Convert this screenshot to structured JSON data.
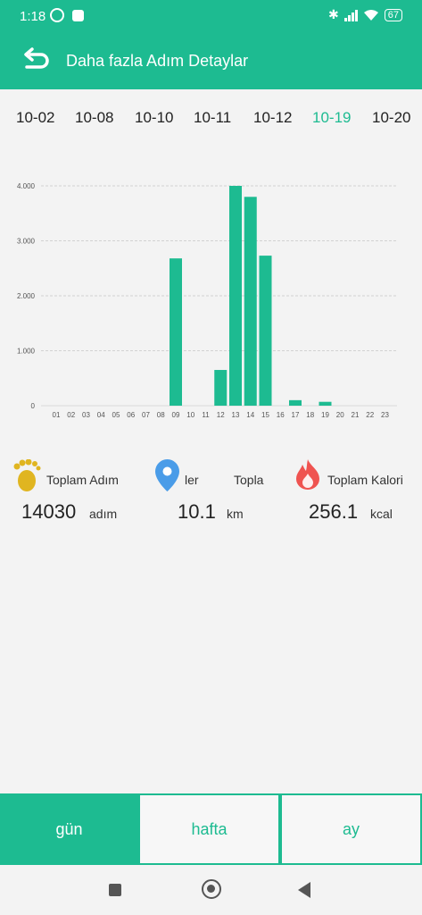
{
  "status_bar": {
    "time": "1:18",
    "battery": "67",
    "icons": [
      "alarm-icon",
      "notification-icon",
      "bluetooth-icon",
      "signal-icon",
      "wifi-icon",
      "battery-icon"
    ]
  },
  "app_bar": {
    "title": "Daha fazla Adım Detaylar",
    "back_icon": "back-arrow-icon"
  },
  "date_tabs": [
    {
      "label": "10-02"
    },
    {
      "label": "10-08"
    },
    {
      "label": "10-10"
    },
    {
      "label": "10-11"
    },
    {
      "label": "10-12"
    },
    {
      "label": "10-19",
      "active": true
    },
    {
      "label": "10-20"
    }
  ],
  "chart_data": {
    "type": "bar",
    "color": "#1dbb91",
    "categories": [
      "01",
      "02",
      "03",
      "04",
      "05",
      "06",
      "07",
      "08",
      "09",
      "10",
      "11",
      "12",
      "13",
      "14",
      "15",
      "16",
      "17",
      "18",
      "19",
      "20",
      "21",
      "22",
      "23"
    ],
    "values": [
      0,
      0,
      0,
      0,
      0,
      0,
      0,
      0,
      2680,
      0,
      0,
      650,
      4000,
      3800,
      2730,
      0,
      100,
      0,
      70,
      0,
      0,
      0,
      0
    ],
    "ylim": [
      0,
      4000
    ],
    "yticks": [
      "0",
      "1.000",
      "2.000",
      "3.000",
      "4.000"
    ],
    "ytick_values": [
      0,
      1000,
      2000,
      3000,
      4000
    ],
    "grid": true
  },
  "stats": {
    "steps": {
      "label": "Toplam Adım",
      "value": "14030",
      "unit": "adım",
      "icon": "footprints-icon"
    },
    "distance": {
      "label_left": "ler",
      "label_right": "Topla",
      "value": "10.1",
      "unit": "km",
      "icon": "location-pin-icon"
    },
    "calories": {
      "label": "Toplam Kalori",
      "value": "256.1",
      "unit": "kcal",
      "icon": "flame-icon"
    }
  },
  "periods": [
    {
      "label": "gün",
      "active": true
    },
    {
      "label": "hafta"
    },
    {
      "label": "ay"
    }
  ],
  "nav": {
    "icons": [
      "recent-apps-icon",
      "home-icon",
      "back-icon"
    ]
  }
}
